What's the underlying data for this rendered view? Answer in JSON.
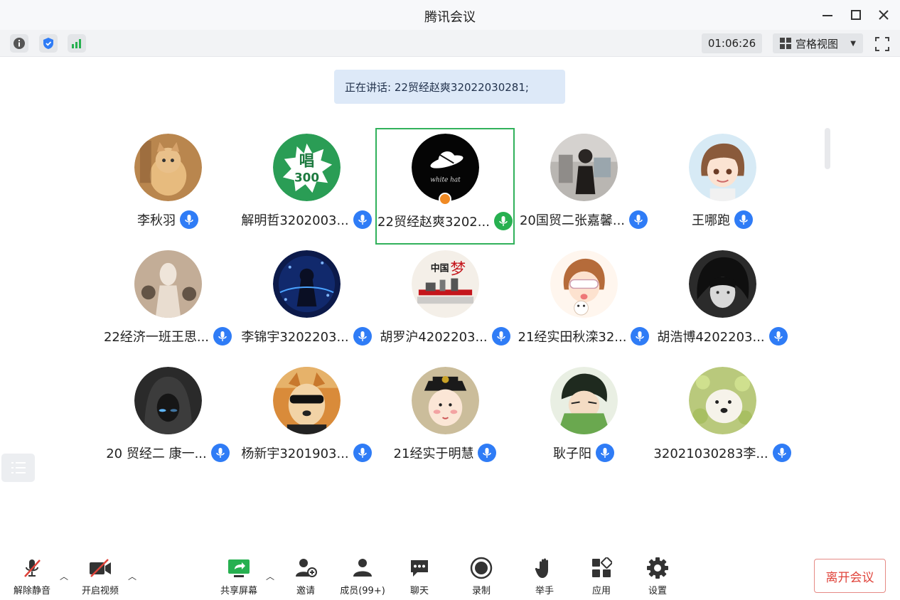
{
  "window": {
    "title": "腾讯会议"
  },
  "toolbar": {
    "timer": "01:06:26",
    "view_mode": "宫格视图"
  },
  "speaking": {
    "text": "正在讲话: 22贸经赵爽32022030281;"
  },
  "participants": [
    {
      "name": "李秋羽",
      "avatar": "avatar-cat-photo",
      "mic": "blue",
      "active": false
    },
    {
      "name": "解明哲3202003...",
      "avatar": "avatar-green-300-badge",
      "mic": "blue",
      "active": false
    },
    {
      "name": "22贸经赵爽3202...",
      "avatar": "avatar-white-hat-logo",
      "mic": "green",
      "active": true,
      "host": true
    },
    {
      "name": "20国贸二张嘉馨...",
      "avatar": "avatar-person-photo",
      "mic": "blue",
      "active": false
    },
    {
      "name": "王哪跑",
      "avatar": "avatar-anime-girl",
      "mic": "blue",
      "active": false
    },
    {
      "name": "22经济一班王思...",
      "avatar": "avatar-figure-photo",
      "mic": "blue",
      "active": false
    },
    {
      "name": "李锦宇3202203...",
      "avatar": "avatar-blue-anime",
      "mic": "blue",
      "active": false
    },
    {
      "name": "胡罗沪4202203...",
      "avatar": "avatar-china-dream",
      "mic": "blue",
      "active": false
    },
    {
      "name": "21经实田秋滦32...",
      "avatar": "avatar-cartoon-girl",
      "mic": "blue",
      "active": false
    },
    {
      "name": "胡浩博4202203...",
      "avatar": "avatar-dark-anime",
      "mic": "blue",
      "active": false
    },
    {
      "name": "20 贸经二 康一...",
      "avatar": "avatar-hooded-figure",
      "mic": "blue",
      "active": false
    },
    {
      "name": "杨新宇3201903...",
      "avatar": "avatar-dog-sunglasses",
      "mic": "blue",
      "active": false
    },
    {
      "name": "21经实于明慧",
      "avatar": "avatar-qing-cartoon",
      "mic": "blue",
      "active": false
    },
    {
      "name": "耿子阳",
      "avatar": "avatar-green-anime",
      "mic": "blue",
      "active": false
    },
    {
      "name": "32021030283李...",
      "avatar": "avatar-dog-flowers",
      "mic": "blue",
      "active": false
    }
  ],
  "controls": {
    "unmute": "解除静音",
    "start_video": "开启视频",
    "share_screen": "共享屏幕",
    "invite": "邀请",
    "members": "成员(99+)",
    "chat": "聊天",
    "record": "录制",
    "raise_hand": "举手",
    "apps": "应用",
    "settings": "设置",
    "leave": "离开会议"
  },
  "colors": {
    "accent": "#2f7cf6",
    "active_border": "#31b15b",
    "leave": "#e0433a",
    "speaking_bg": "#dde9f8"
  }
}
